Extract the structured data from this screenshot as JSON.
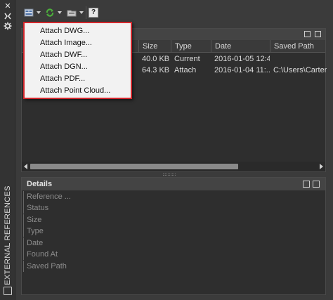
{
  "sidebar": {
    "title": "EXTERNAL REFERENCES",
    "close_icon": "close-icon",
    "collapse_icon": "collapse-icon",
    "settings_icon": "gear-icon"
  },
  "toolbar": {
    "attach_icon": "attach-dwg-icon",
    "refresh_icon": "refresh-icon",
    "change_path_icon": "change-path-icon",
    "help_icon": "help-icon",
    "help_glyph": "?"
  },
  "attach_menu": {
    "items": [
      {
        "label": "Attach DWG..."
      },
      {
        "label": "Attach Image..."
      },
      {
        "label": "Attach DWF..."
      },
      {
        "label": "Attach DGN..."
      },
      {
        "label": "Attach PDF..."
      },
      {
        "label": "Attach Point Cloud..."
      }
    ],
    "highlight_color": "#d1262c"
  },
  "file_refs": {
    "columns": {
      "size": "Size",
      "type": "Type",
      "date": "Date",
      "saved_path": "Saved Path"
    },
    "rows": [
      {
        "size": "40.0 KB",
        "type": "Current",
        "date": "2016-01-05 12:4...",
        "saved_path": ""
      },
      {
        "size": "64.3 KB",
        "type": "Attach",
        "date": "2016-01-04 11:...",
        "saved_path": "C:\\Users\\Carter\\D"
      }
    ]
  },
  "details": {
    "title": "Details",
    "properties": [
      {
        "label": "Reference ..."
      },
      {
        "label": "Status"
      },
      {
        "label": "Size"
      },
      {
        "label": "Type"
      },
      {
        "label": "Date"
      },
      {
        "label": "Found At"
      },
      {
        "label": "Saved Path"
      }
    ]
  }
}
